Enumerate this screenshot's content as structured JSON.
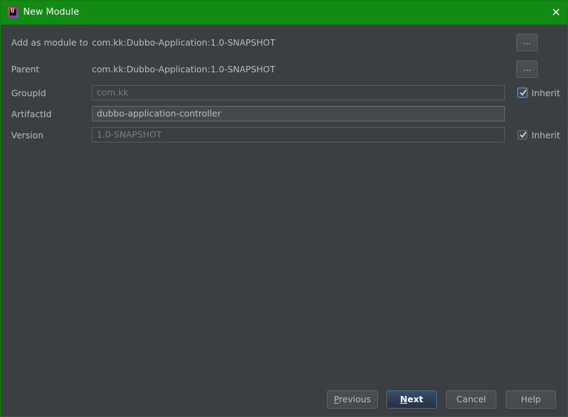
{
  "window": {
    "title": "New Module",
    "icon": "intellij-idea-icon",
    "close": "✕"
  },
  "form": {
    "add_as_module_label": "Add as module to",
    "add_as_module_value": "com.kk:Dubbo-Application:1.0-SNAPSHOT",
    "parent_label": "Parent",
    "parent_value": "com.kk:Dubbo-Application:1.0-SNAPSHOT",
    "browse_label": "...",
    "groupid_label": "GroupId",
    "groupid_value": "com.kk",
    "artifactid_label": "ArtifactId",
    "artifactid_value": "dubbo-application-controller",
    "version_label": "Version",
    "version_value": "1.0-SNAPSHOT",
    "inherit_label": "Inherit",
    "groupid_inherit_checked": true,
    "version_inherit_checked": true
  },
  "buttons": {
    "previous": "Previous",
    "next": "Next",
    "cancel": "Cancel",
    "help": "Help"
  },
  "colors": {
    "titlebar": "#138a12",
    "background": "#3c3f41",
    "default_button": "#2e4460"
  }
}
